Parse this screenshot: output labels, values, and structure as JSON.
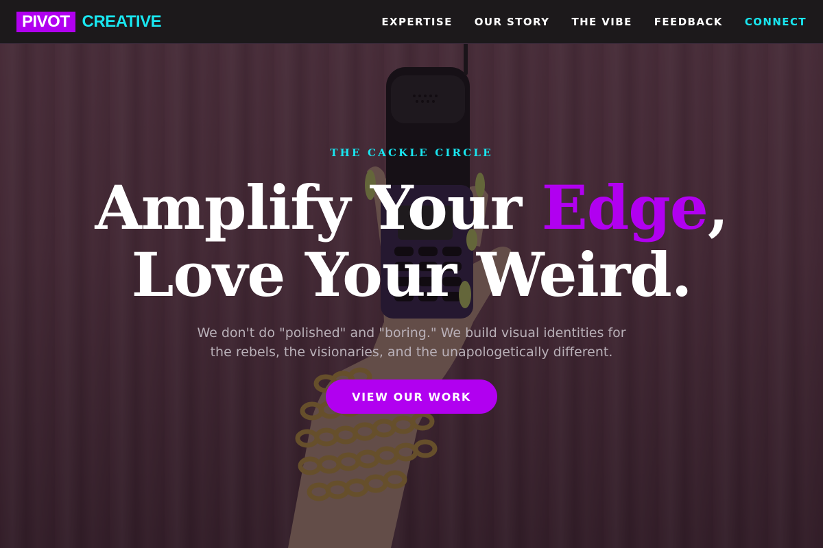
{
  "brand": {
    "name_part1": "PIVOT",
    "name_part2": "CREATIVE",
    "color_primary": "#b100f0",
    "color_accent": "#19e6f0"
  },
  "nav": {
    "items": [
      {
        "label": "EXPERTISE"
      },
      {
        "label": "OUR STORY"
      },
      {
        "label": "THE VIBE"
      },
      {
        "label": "FEEDBACK"
      },
      {
        "label": "CONNECT"
      }
    ]
  },
  "hero": {
    "eyebrow": "THE CACKLE CIRCLE",
    "headline_part1": "Amplify Your ",
    "headline_accent": "Edge",
    "headline_part2": ",",
    "headline_line2": "Love Your Weird.",
    "subtext_line1": "We don't do \"polished\" and \"boring.\" We build visual identities for",
    "subtext_line2": "the rebels, the visionaries, and the unapologetically different.",
    "cta_label": "VIEW OUR WORK",
    "background_icon": "hand-holding-flip-phone-photo"
  }
}
